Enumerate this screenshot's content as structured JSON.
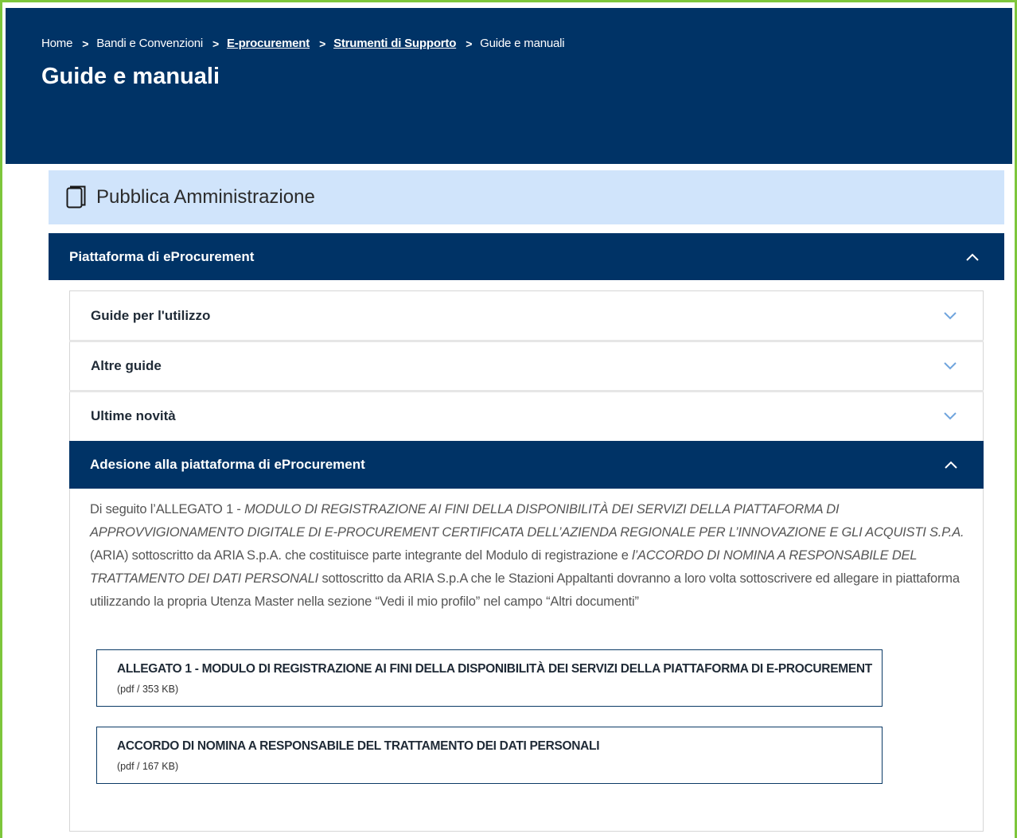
{
  "breadcrumb": {
    "items": [
      {
        "label": "Home"
      },
      {
        "label": "Bandi e Convenzioni"
      },
      {
        "label": "E-procurement"
      },
      {
        "label": "Strumenti di Supporto"
      },
      {
        "label": "Guide e manuali"
      }
    ],
    "separator": ">"
  },
  "page": {
    "title": "Guide e manuali"
  },
  "section": {
    "title": "Pubblica Amministrazione",
    "icon": "book-icon"
  },
  "accordion": {
    "main_label": "Piattaforma di eProcurement",
    "items": [
      {
        "label": "Guide per l'utilizzo"
      },
      {
        "label": "Altre guide"
      },
      {
        "label": "Ultime novità"
      },
      {
        "label": "Adesione alla piattaforma di eProcurement"
      }
    ]
  },
  "description": {
    "part1": "Di seguito l’ALLEGATO 1 - ",
    "italic1": "MODULO DI REGISTRAZIONE AI FINI DELLA DISPONIBILITÀ DEI SERVIZI DELLA PIATTAFORMA DI APPROVVIGIONAMENTO DIGITALE DI E-PROCUREMENT CERTIFICATA DELL’AZIENDA REGIONALE PER L’INNOVAZIONE E GLI ACQUISTI S.P.A.",
    "part2": " (ARIA) sottoscritto da ARIA S.p.A. che costituisce parte integrante del Modulo di registrazione e ",
    "italic2": "l’ACCORDO DI NOMINA A RESPONSABILE DEL TRATTAMENTO DEI DATI PERSONALI",
    "part3": " sottoscritto da ARIA S.p.A che le Stazioni Appaltanti dovranno a loro volta sottoscrivere ed allegare in piattaforma utilizzando la propria Utenza Master nella sezione “Vedi il mio profilo” nel campo “Altri documenti”"
  },
  "documents": [
    {
      "title": "ALLEGATO 1 - MODULO DI REGISTRAZIONE AI FINI DELLA DISPONIBILITÀ DEI SERVIZI DELLA PIATTAFORMA DI E-PROCUREMENT",
      "meta": "(pdf / 353 KB)"
    },
    {
      "title": "ACCORDO DI NOMINA A RESPONSABILE DEL TRATTAMENTO DEI DATI PERSONALI",
      "meta": "(pdf / 167 KB)"
    }
  ],
  "colors": {
    "primary": "#003366",
    "section_bg": "#d0e4fb",
    "frame_accent": "#7dc63b",
    "chevron_light": "#6fa4dd"
  }
}
